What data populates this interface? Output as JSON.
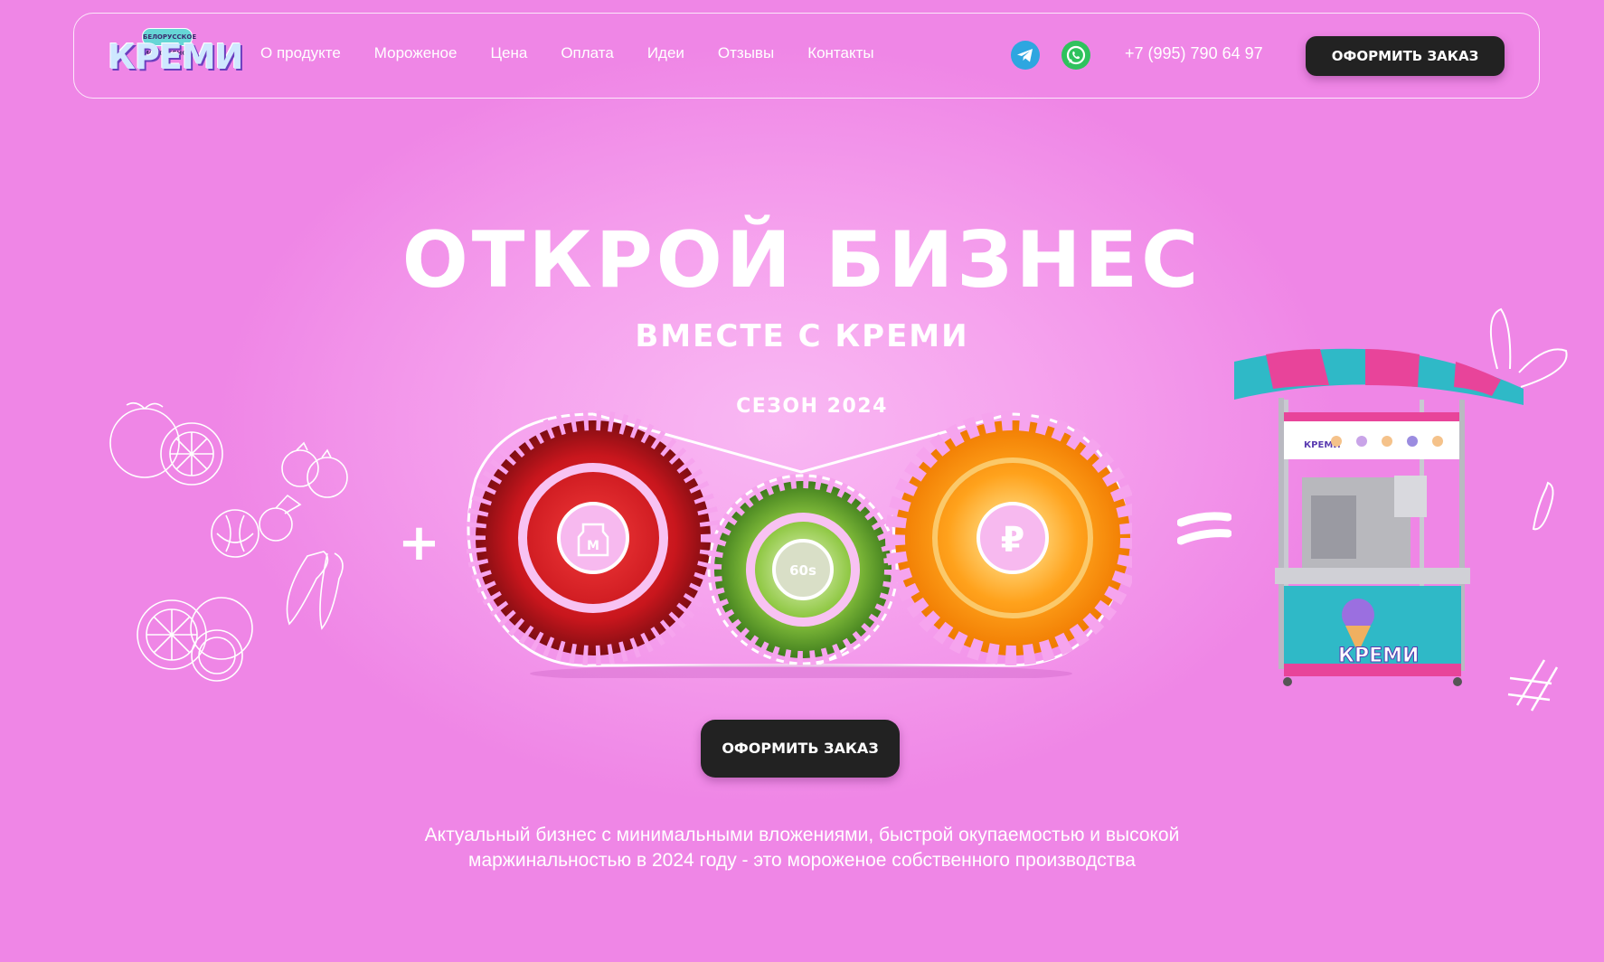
{
  "header": {
    "logo": {
      "main": "КРЕМИ",
      "sub": "БЕЛОРУССКОЕ МОРОЖЕНОЕ"
    },
    "nav": [
      {
        "label": "О продукте"
      },
      {
        "label": "Мороженое"
      },
      {
        "label": "Цена"
      },
      {
        "label": "Оплата"
      },
      {
        "label": "Идеи"
      },
      {
        "label": "Отзывы"
      },
      {
        "label": "Контакты"
      }
    ],
    "social": [
      "telegram-icon",
      "whatsapp-icon"
    ],
    "phone": "+7 (995) 790 64 97",
    "order_button": "ОФОРМИТЬ ЗАКАЗ"
  },
  "hero": {
    "title": "ОТКРОЙ БИЗНЕС",
    "subtitle": "ВМЕСТЕ С КРЕМИ",
    "season": "СЕЗОН 2024",
    "formula": {
      "plus": "+",
      "circles": [
        {
          "icon": "milk-bottle-icon",
          "glyph": "M",
          "fruit": "strawberry"
        },
        {
          "icon": "timer-60s-icon",
          "glyph": "60s",
          "fruit": "kiwi"
        },
        {
          "icon": "ruble-icon",
          "glyph": "₽",
          "fruit": "orange"
        }
      ]
    },
    "order_button": "ОФОРМИТЬ ЗАКАЗ",
    "description": "Актуальный бизнес с минимальными вложениями, быстрой окупаемостью и высокой маржинальностью в 2024 году - это мороженое собственного производства"
  },
  "kiosk": {
    "brand": "КРЕМИ"
  },
  "colors": {
    "background": "#ef86e6",
    "button": "#222222",
    "telegram": "#2ea6e0",
    "whatsapp": "#2fc25d"
  }
}
